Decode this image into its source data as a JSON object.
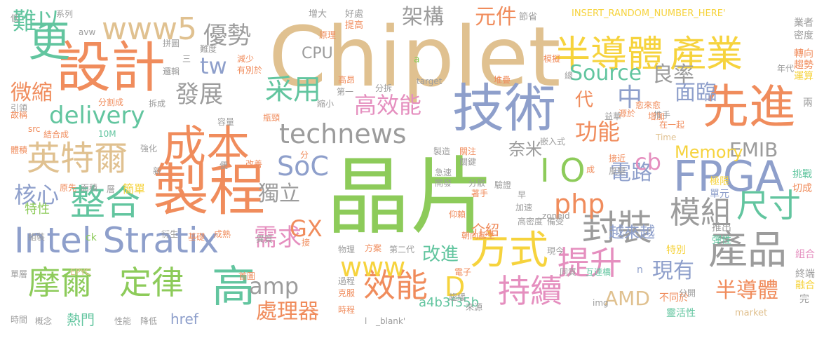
{
  "palette": {
    "orange": "#F08C5C",
    "green": "#8DCB5A",
    "blue": "#8E9FCB",
    "sand": "#E0C190",
    "gray": "#9C9C9C",
    "teal": "#62C59F",
    "yellow": "#F6D33D",
    "pink": "#E58FBF"
  },
  "words": [
    {
      "text": "Chiplet",
      "color": "sand"
    },
    {
      "text": "晶片",
      "color": "green"
    },
    {
      "text": "技術",
      "color": "blue"
    },
    {
      "text": "製程",
      "color": "orange"
    },
    {
      "text": "設計",
      "color": "orange"
    },
    {
      "text": "成本",
      "color": "orange"
    },
    {
      "text": "半導體",
      "color": "yellow"
    },
    {
      "text": "產業",
      "color": "yellow"
    },
    {
      "text": "先進",
      "color": "orange"
    },
    {
      "text": "FPGA",
      "color": "blue"
    },
    {
      "text": "I O",
      "color": "green"
    },
    {
      "text": "Intel Stratix",
      "color": "blue"
    },
    {
      "text": "整合",
      "color": "teal"
    },
    {
      "text": "英特爾",
      "color": "sand"
    },
    {
      "text": "高",
      "color": "teal"
    },
    {
      "text": "方式",
      "color": "yellow"
    },
    {
      "text": "產品",
      "color": "gray"
    },
    {
      "text": "www5",
      "color": "sand"
    },
    {
      "text": "更",
      "color": "teal"
    },
    {
      "text": "摩爾",
      "color": "green"
    },
    {
      "text": "定律",
      "color": "green"
    },
    {
      "text": "封裝",
      "color": "gray"
    },
    {
      "text": "效能",
      "color": "orange"
    },
    {
      "text": "持續",
      "color": "pink"
    },
    {
      "text": "提升",
      "color": "pink"
    },
    {
      "text": "尺寸",
      "color": "teal"
    },
    {
      "text": "模組",
      "color": "gray"
    },
    {
      "text": "采用",
      "color": "teal"
    },
    {
      "text": "technews",
      "color": "gray"
    },
    {
      "text": "delivery",
      "color": "teal"
    },
    {
      "text": "SoC",
      "color": "blue"
    },
    {
      "text": "php",
      "color": "orange"
    },
    {
      "text": "優勢",
      "color": "gray"
    },
    {
      "text": "發展",
      "color": "gray"
    },
    {
      "text": "難以",
      "color": "teal"
    },
    {
      "text": "核心",
      "color": "blue"
    },
    {
      "text": "需求",
      "color": "pink"
    },
    {
      "text": "高效能",
      "color": "pink"
    },
    {
      "text": "功能",
      "color": "orange"
    },
    {
      "text": "中",
      "color": "blue"
    },
    {
      "text": "良率",
      "color": "gray"
    },
    {
      "text": "面臨",
      "color": "blue"
    },
    {
      "text": "電路",
      "color": "blue"
    },
    {
      "text": "半導體",
      "color": "orange"
    },
    {
      "text": "www",
      "color": "yellow"
    },
    {
      "text": "amp",
      "color": "gray"
    },
    {
      "text": "現有",
      "color": "blue"
    },
    {
      "text": "tw",
      "color": "blue"
    },
    {
      "text": "處理器",
      "color": "orange"
    },
    {
      "text": "cb",
      "color": "pink"
    },
    {
      "text": "D",
      "color": "yellow"
    },
    {
      "text": "EMIB",
      "color": "gray"
    },
    {
      "text": "獨立",
      "color": "gray"
    },
    {
      "text": "GX",
      "color": "orange"
    },
    {
      "text": "AMD",
      "color": "sand"
    },
    {
      "text": "微縮",
      "color": "orange"
    },
    {
      "text": "架構",
      "color": "gray"
    },
    {
      "text": "元件",
      "color": "orange"
    },
    {
      "text": "Source",
      "color": "teal"
    },
    {
      "text": "Memory",
      "color": "yellow"
    },
    {
      "text": "越來越",
      "color": "blue"
    },
    {
      "text": "改進",
      "color": "teal"
    },
    {
      "text": "代",
      "color": "orange"
    },
    {
      "text": "奈米",
      "color": "gray"
    },
    {
      "text": "介紹",
      "color": "orange"
    },
    {
      "text": "CPU",
      "color": "gray"
    },
    {
      "text": "href",
      "color": "blue"
    },
    {
      "text": "a4b3f35b",
      "color": "teal"
    },
    {
      "text": "熱門",
      "color": "teal"
    },
    {
      "text": "簡單",
      "color": "yellow"
    },
    {
      "text": "特性",
      "color": "green"
    },
    {
      "text": "INSERT_RANDOM_NUMBER_HERE'",
      "color": "yellow"
    },
    {
      "text": "業者",
      "color": "gray"
    },
    {
      "text": "密度",
      "color": "gray"
    },
    {
      "text": "轉向",
      "color": "orange"
    },
    {
      "text": "趨勢",
      "color": "orange"
    },
    {
      "text": "運算",
      "color": "yellow"
    },
    {
      "text": "年代",
      "color": "gray"
    },
    {
      "text": "兩",
      "color": "gray"
    },
    {
      "text": "挑戰",
      "color": "teal"
    },
    {
      "text": "切成",
      "color": "orange"
    },
    {
      "text": "極限",
      "color": "yellow"
    },
    {
      "text": "單元",
      "color": "blue"
    },
    {
      "text": "推出",
      "color": "gray"
    },
    {
      "text": "彈性",
      "color": "teal"
    },
    {
      "text": "特別",
      "color": "yellow"
    },
    {
      "text": "組合",
      "color": "pink"
    },
    {
      "text": "終端",
      "color": "gray"
    },
    {
      "text": "融合",
      "color": "yellow"
    },
    {
      "text": "完",
      "color": "gray"
    },
    {
      "text": "不同於",
      "color": "orange"
    },
    {
      "text": "靈活性",
      "color": "teal"
    },
    {
      "text": "market",
      "color": "sand"
    },
    {
      "text": "分開",
      "color": "gray"
    },
    {
      "text": "img",
      "color": "gray"
    },
    {
      "text": "低",
      "color": "gray"
    },
    {
      "text": "系列",
      "color": "gray"
    },
    {
      "text": "avw",
      "color": "gray"
    },
    {
      "text": "增大",
      "color": "gray"
    },
    {
      "text": "好處",
      "color": "gray"
    },
    {
      "text": "提高",
      "color": "orange"
    },
    {
      "text": "節省",
      "color": "gray"
    },
    {
      "text": "拼圖",
      "color": "gray"
    },
    {
      "text": "三",
      "color": "gray"
    },
    {
      "text": "邏輯",
      "color": "gray"
    },
    {
      "text": "難度",
      "color": "gray"
    },
    {
      "text": "減少",
      "color": "orange"
    },
    {
      "text": "有別於",
      "color": "orange"
    },
    {
      "text": "原理",
      "color": "orange"
    },
    {
      "text": "a",
      "color": "green"
    },
    {
      "text": "模擬",
      "color": "orange"
    },
    {
      "text": "總",
      "color": "gray"
    },
    {
      "text": "高昂",
      "color": "orange"
    },
    {
      "text": "堆疊",
      "color": "orange"
    },
    {
      "text": "target",
      "color": "gray"
    },
    {
      "text": "第一",
      "color": "gray"
    },
    {
      "text": "分拆",
      "color": "gray"
    },
    {
      "text": "愈來愈",
      "color": "orange"
    },
    {
      "text": "推手",
      "color": "gray"
    },
    {
      "text": "嵌入式",
      "color": "gray"
    },
    {
      "text": "在一起",
      "color": "orange"
    },
    {
      "text": "增加",
      "color": "orange"
    },
    {
      "text": "Time",
      "color": "sand"
    },
    {
      "text": "益華",
      "color": "gray"
    },
    {
      "text": "源於",
      "color": "orange"
    },
    {
      "text": "分割成",
      "color": "orange"
    },
    {
      "text": "拆成",
      "color": "gray"
    },
    {
      "text": "縮小",
      "color": "gray"
    },
    {
      "text": "瓶頸",
      "color": "orange"
    },
    {
      "text": "容量",
      "color": "gray"
    },
    {
      "text": "故稱",
      "color": "orange"
    },
    {
      "text": "src",
      "color": "orange"
    },
    {
      "text": "引領",
      "color": "gray"
    },
    {
      "text": "結合成",
      "color": "orange"
    },
    {
      "text": "10M",
      "color": "teal"
    },
    {
      "text": "強化",
      "color": "gray"
    },
    {
      "text": "體積",
      "color": "orange"
    },
    {
      "text": "新",
      "color": "gray"
    },
    {
      "text": "便",
      "color": "gray"
    },
    {
      "text": "改善",
      "color": "orange"
    },
    {
      "text": "分",
      "color": "orange"
    },
    {
      "text": "製造",
      "color": "gray"
    },
    {
      "text": "關注",
      "color": "orange"
    },
    {
      "text": "關鍵",
      "color": "gray"
    },
    {
      "text": "接近",
      "color": "orange"
    },
    {
      "text": "風驅",
      "color": "gray"
    },
    {
      "text": "成",
      "color": "orange"
    },
    {
      "text": "急速",
      "color": "gray"
    },
    {
      "text": "開發",
      "color": "gray"
    },
    {
      "text": "分散",
      "color": "gray"
    },
    {
      "text": "驗證",
      "color": "gray"
    },
    {
      "text": "早",
      "color": "gray"
    },
    {
      "text": "著手",
      "color": "orange"
    },
    {
      "text": "原先",
      "color": "orange"
    },
    {
      "text": "面積",
      "color": "gray"
    },
    {
      "text": "層",
      "color": "gray"
    },
    {
      "text": "加速",
      "color": "gray"
    },
    {
      "text": "備受",
      "color": "gray"
    },
    {
      "text": "仰賴",
      "color": "orange"
    },
    {
      "text": "朝向誕生",
      "color": "orange"
    },
    {
      "text": "高密度",
      "color": "gray"
    },
    {
      "text": "zoneid",
      "color": "gray"
    },
    {
      "text": "組裝",
      "color": "gray"
    },
    {
      "text": "ck",
      "color": "green"
    },
    {
      "text": "衍生",
      "color": "gray"
    },
    {
      "text": "基礎",
      "color": "orange"
    },
    {
      "text": "成熟",
      "color": "orange"
    },
    {
      "text": "異質",
      "color": "gray"
    },
    {
      "text": "接",
      "color": "orange"
    },
    {
      "text": "物理",
      "color": "gray"
    },
    {
      "text": "方案",
      "color": "orange"
    },
    {
      "text": "第二代",
      "color": "gray"
    },
    {
      "text": "現今",
      "color": "gray"
    },
    {
      "text": "單層",
      "color": "gray"
    },
    {
      "text": "EPYC",
      "color": "sand"
    },
    {
      "text": "首圖",
      "color": "orange"
    },
    {
      "text": "過程",
      "color": "gray"
    },
    {
      "text": "克服",
      "color": "orange"
    },
    {
      "text": "電子",
      "color": "orange"
    },
    {
      "text": "同質",
      "color": "gray"
    },
    {
      "text": "互連橋",
      "color": "teal"
    },
    {
      "text": "n",
      "color": "blue"
    },
    {
      "text": "趨緩",
      "color": "gray"
    },
    {
      "text": "來源",
      "color": "gray"
    },
    {
      "text": "時程",
      "color": "orange"
    },
    {
      "text": "時間",
      "color": "gray"
    },
    {
      "text": "概念",
      "color": "gray"
    },
    {
      "text": "性能",
      "color": "gray"
    },
    {
      "text": "降低",
      "color": "gray"
    },
    {
      "text": "l",
      "color": "gray"
    },
    {
      "text": "_blank'",
      "color": "gray"
    }
  ]
}
